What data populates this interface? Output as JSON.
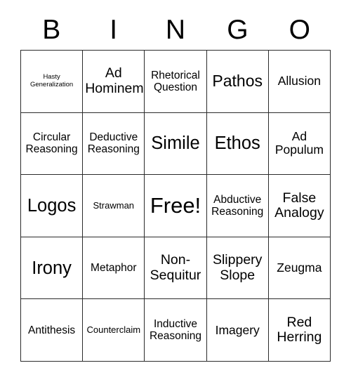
{
  "card": {
    "header_letters": [
      "B",
      "I",
      "N",
      "G",
      "O"
    ],
    "columns": 5,
    "rows": 5,
    "border_color": "#2b2b2b",
    "background_color": "#ffffff",
    "text_color": "#000000",
    "cells": [
      {
        "text": "Hasty\nGeneralization",
        "size": "xs"
      },
      {
        "text": "Ad\nHominem",
        "size": "l"
      },
      {
        "text": "Rhetorical\nQuestion",
        "size": "m"
      },
      {
        "text": "Pathos",
        "size": "xl"
      },
      {
        "text": "Allusion",
        "size": "ml"
      },
      {
        "text": "Circular\nReasoning",
        "size": "m"
      },
      {
        "text": "Deductive\nReasoning",
        "size": "m"
      },
      {
        "text": "Simile",
        "size": "xxl"
      },
      {
        "text": "Ethos",
        "size": "xxl"
      },
      {
        "text": "Ad\nPopulum",
        "size": "ml"
      },
      {
        "text": "Logos",
        "size": "xxl"
      },
      {
        "text": "Strawman",
        "size": "s"
      },
      {
        "text": "Free!",
        "size": "free"
      },
      {
        "text": "Abductive\nReasoning",
        "size": "m"
      },
      {
        "text": "False\nAnalogy",
        "size": "l"
      },
      {
        "text": "Irony",
        "size": "xxl"
      },
      {
        "text": "Metaphor",
        "size": "m"
      },
      {
        "text": "Non-\nSequitur",
        "size": "l"
      },
      {
        "text": "Slippery\nSlope",
        "size": "l"
      },
      {
        "text": "Zeugma",
        "size": "ml"
      },
      {
        "text": "Antithesis",
        "size": "m"
      },
      {
        "text": "Counterclaim",
        "size": "s"
      },
      {
        "text": "Inductive\nReasoning",
        "size": "m"
      },
      {
        "text": "Imagery",
        "size": "ml"
      },
      {
        "text": "Red\nHerring",
        "size": "l"
      }
    ]
  }
}
